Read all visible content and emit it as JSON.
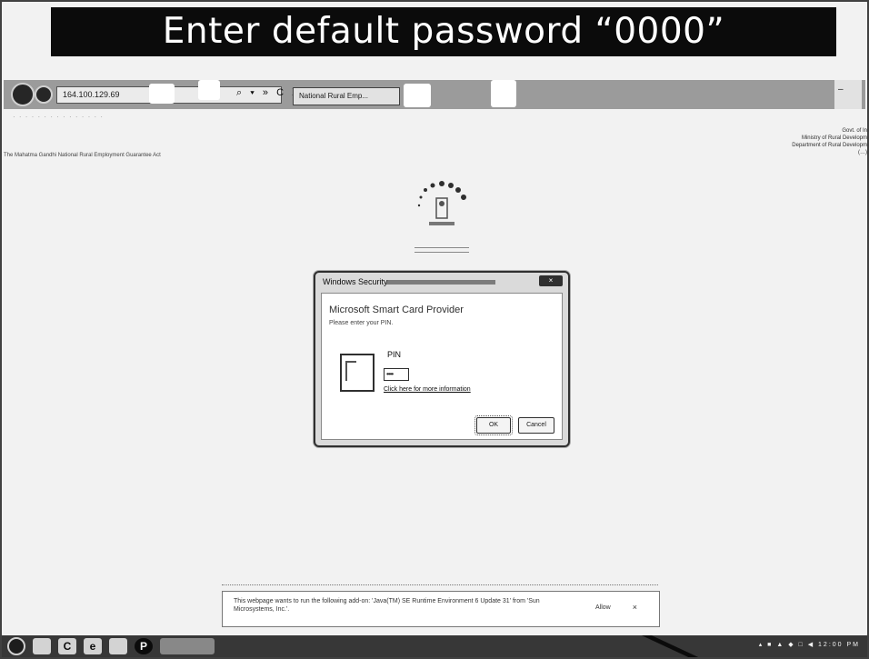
{
  "banner": {
    "text": "Enter default password “0000”"
  },
  "browser": {
    "address": "164.100.129.69",
    "tab_title": "National Rural Emp...",
    "address_icons": "⌕ ▾ » C X",
    "window_controls": "–"
  },
  "page": {
    "left_caption": "The Mahatma Gandhi National Rural Employment Guarantee Act",
    "gov_lines": [
      "Govt. of In",
      "Ministry of Rural Developm",
      "Department of Rural Developm",
      "(…)"
    ]
  },
  "dialog": {
    "title": "Windows Security",
    "close_label": "×",
    "provider": "Microsoft Smart Card Provider",
    "prompt": "Please enter your PIN.",
    "pin_label": "PIN",
    "pin_value": "••••",
    "info_link": "Click here for more information",
    "ok_label": "OK",
    "cancel_label": "Cancel"
  },
  "notification": {
    "text": "This webpage wants to run the following add-on: 'Java(TM) SE Runtime Environment 6 Update 31' from 'Sun Microsystems, Inc.'.",
    "allow_label": "Allow",
    "close_label": "×"
  },
  "taskbar": {
    "icons": [
      "e",
      "C",
      "P"
    ],
    "tray": "▴ ■ ▲ ◆ □ ◀   12:00 PM"
  }
}
